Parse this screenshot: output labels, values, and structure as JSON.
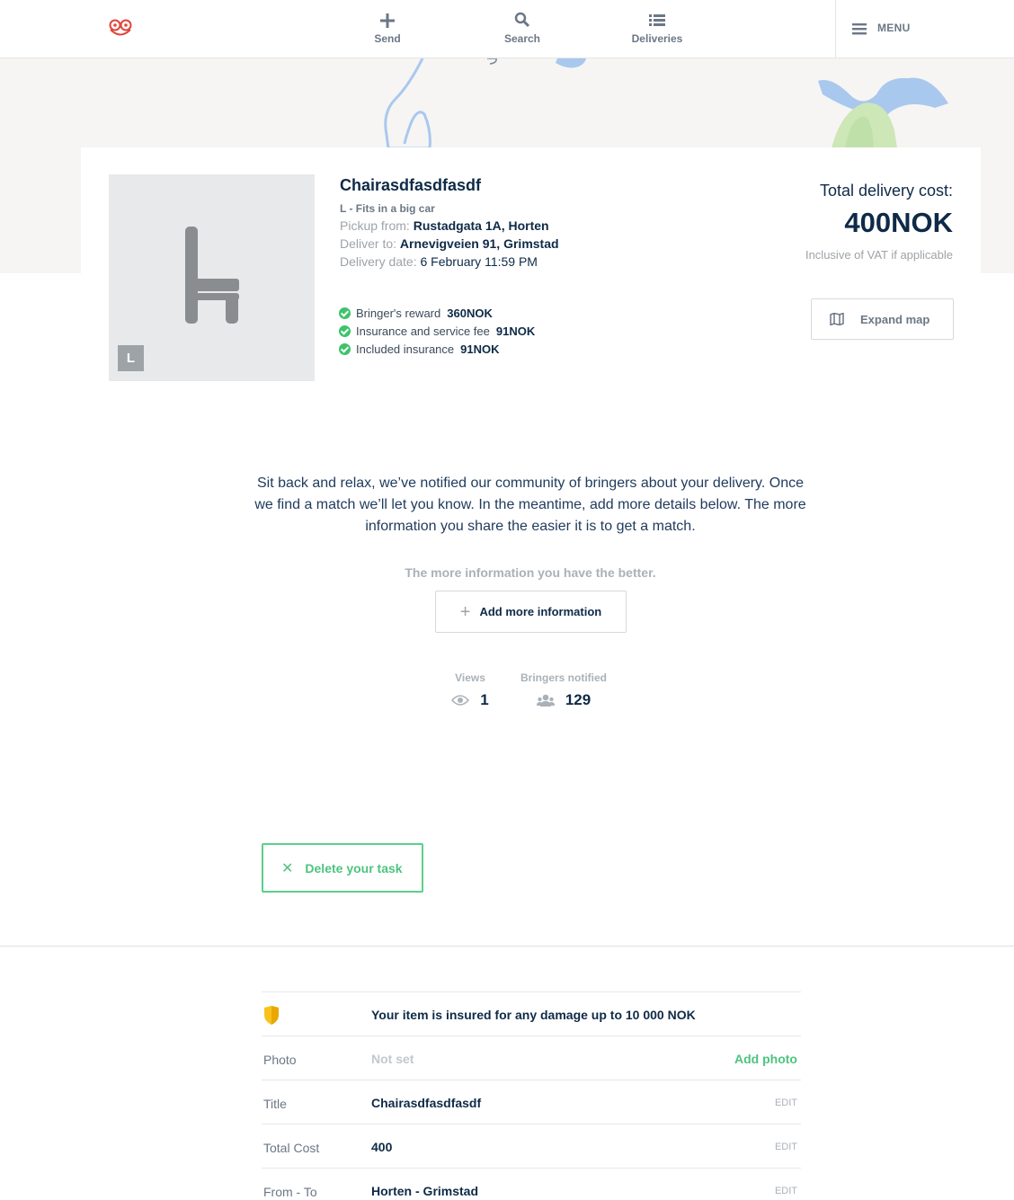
{
  "nav": {
    "send": "Send",
    "search": "Search",
    "deliveries": "Deliveries",
    "menu": "MENU"
  },
  "task": {
    "title": "Chairasdfasdfasdf",
    "size_badge": "L",
    "size_desc": "L - Fits in a big car",
    "pickup_label": "Pickup from:",
    "pickup_value": "Rustadgata 1A, Horten",
    "deliver_label": "Deliver to:",
    "deliver_value": "Arnevigveien 91, Grimstad",
    "date_label": "Delivery date:",
    "date_value": "6 February 11:59 PM",
    "fees": [
      {
        "label": "Bringer's reward",
        "amount": "360NOK"
      },
      {
        "label": "Insurance and service fee",
        "amount": "91NOK"
      },
      {
        "label": "Included insurance",
        "amount": "91NOK"
      }
    ],
    "cost_label": "Total delivery cost:",
    "cost_value": "400NOK",
    "vat_note": "Inclusive of VAT if applicable",
    "expand_map": "Expand map"
  },
  "status": {
    "relax_text": "Sit back and relax, we’ve notified our community of bringers about your delivery. Once we find a match we’ll let you know. In the meantime, add more details below. The more information you share the easier it is to get a match.",
    "more_info_hint": "The more information you have the better.",
    "add_more_button": "Add more information",
    "views_label": "Views",
    "views_value": "1",
    "bringers_label": "Bringers notified",
    "bringers_value": "129",
    "delete_button": "Delete your task"
  },
  "details": {
    "insurance_text": "Your item is insured for any damage up to 10 000 NOK",
    "rows": [
      {
        "label": "Photo",
        "value": "Not set",
        "action": "Add photo"
      },
      {
        "label": "Title",
        "value": "Chairasdfasdfasdf",
        "action": "EDIT"
      },
      {
        "label": "Total Cost",
        "value": "400",
        "action": "EDIT"
      },
      {
        "label": "From - To",
        "value": "Horten - Grimstad",
        "action": "EDIT"
      }
    ]
  },
  "colors": {
    "accent_green": "#4cc47f",
    "navy": "#0e2a47",
    "logo_red": "#e0463a",
    "shield_yellow": "#f7c21c"
  }
}
